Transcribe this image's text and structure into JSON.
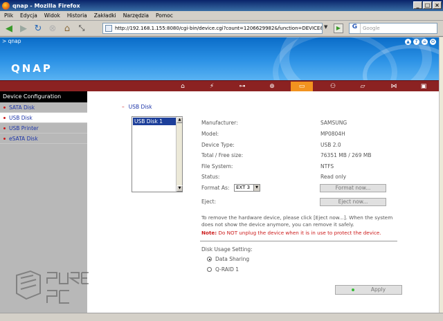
{
  "window": {
    "title": "qnap - Mozilla Firefox"
  },
  "menu": [
    "Plik",
    "Edycja",
    "Widok",
    "Historia",
    "Zakładki",
    "Narzędzia",
    "Pomoc"
  ],
  "browser": {
    "url": "http://192.168.1.155:8080/cgi-bin/device.cgi?count=1206629982&function=DEVICE&subfun=USB_",
    "search_placeholder": "Google"
  },
  "header": {
    "breadcrumb": "> qnap",
    "logo": "QNAP"
  },
  "sidebar": {
    "title": "Device Configuration",
    "items": [
      {
        "label": "SATA Disk",
        "active": false
      },
      {
        "label": "USB Disk",
        "active": true
      },
      {
        "label": "USB Printer",
        "active": false
      },
      {
        "label": "eSATA Disk",
        "active": false
      }
    ]
  },
  "main": {
    "section_title": "USB Disk",
    "disks": [
      "USB Disk 1"
    ],
    "info": [
      {
        "label": "Manufacturer:",
        "value": "SAMSUNG"
      },
      {
        "label": "Model:",
        "value": "MP0804H"
      },
      {
        "label": "Device Type:",
        "value": "USB 2.0"
      },
      {
        "label": "Total / Free size:",
        "value": "76351 MB / 269 MB"
      },
      {
        "label": "File System:",
        "value": "NTFS"
      },
      {
        "label": "Status:",
        "value": "Read only"
      }
    ],
    "format_label": "Format As:",
    "format_value": "EXT 3",
    "format_button": "Format now...",
    "eject_label": "Eject:",
    "eject_button": "Eject now...",
    "notice": "To remove the hardware device, please click [Eject now...]. When the system does not show the device anymore, you can remove it safely.",
    "note_label": "Note:",
    "note_text": "Do NOT unplug the device when it is in use to protect the device.",
    "usage_title": "Disk Usage Setting:",
    "usage_options": [
      {
        "label": "Data Sharing",
        "selected": true
      },
      {
        "label": "Q-RAID 1",
        "selected": false
      }
    ],
    "apply_button": "Apply"
  },
  "watermark": "PURE PC"
}
